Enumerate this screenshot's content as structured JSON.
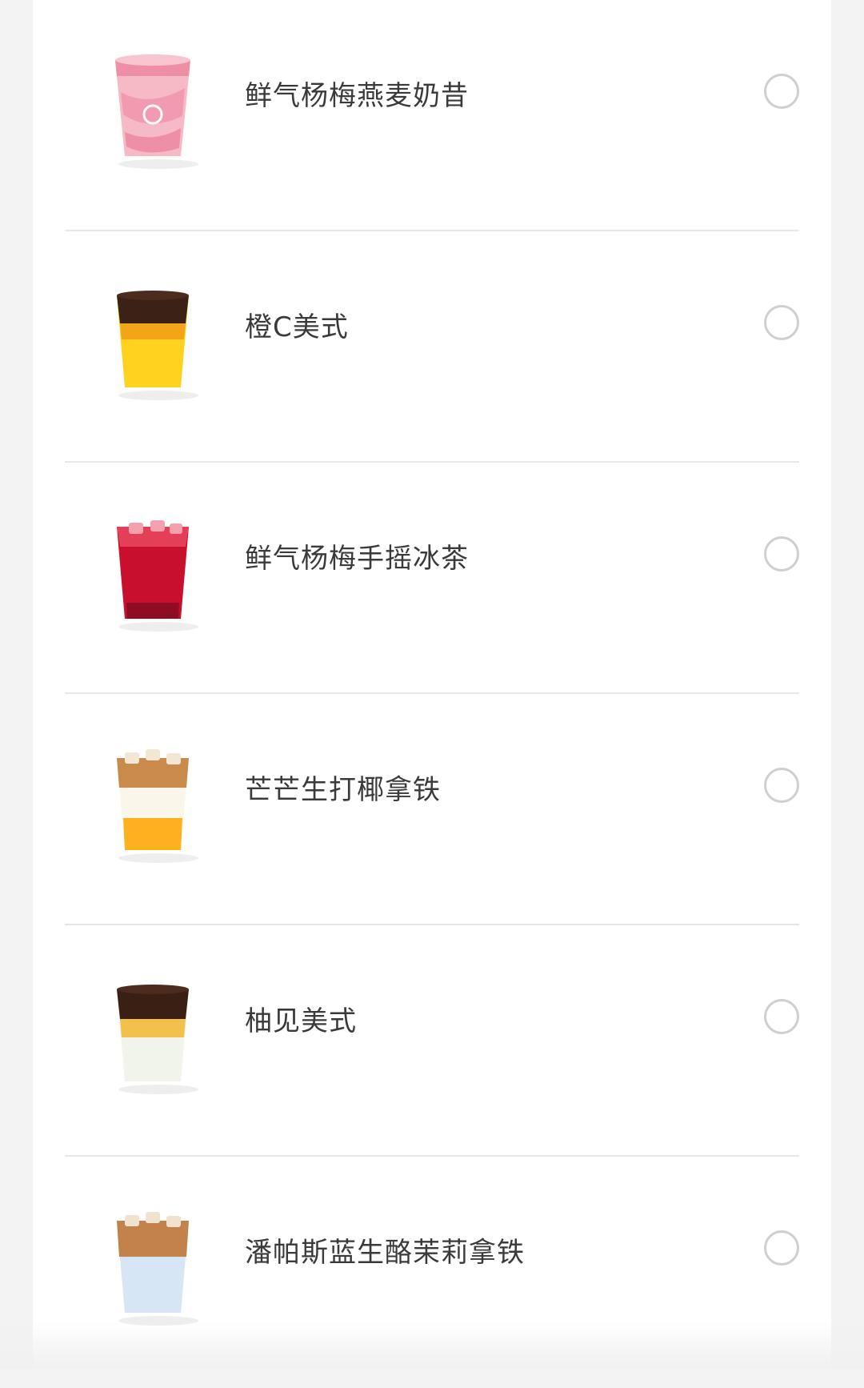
{
  "items": [
    {
      "name": "鲜气杨梅燕麦奶昔",
      "icon": "pink-smoothie-cup-icon",
      "selected": false
    },
    {
      "name": "橙C美式",
      "icon": "orange-americano-cup-icon",
      "selected": false
    },
    {
      "name": "鲜气杨梅手摇冰茶",
      "icon": "red-iced-tea-cup-icon",
      "selected": false
    },
    {
      "name": "芒芒生打椰拿铁",
      "icon": "mango-coconut-latte-cup-icon",
      "selected": false
    },
    {
      "name": "柚见美式",
      "icon": "grapefruit-americano-cup-icon",
      "selected": false
    },
    {
      "name": "潘帕斯蓝生酪茉莉拿铁",
      "icon": "blue-jasmine-latte-cup-icon",
      "selected": false
    }
  ],
  "colors": {
    "background": "#f3f3f3",
    "card": "#ffffff",
    "divider": "#e7e7e7",
    "radio_border": "#cfcfcf",
    "text": "#3a3a3a"
  }
}
